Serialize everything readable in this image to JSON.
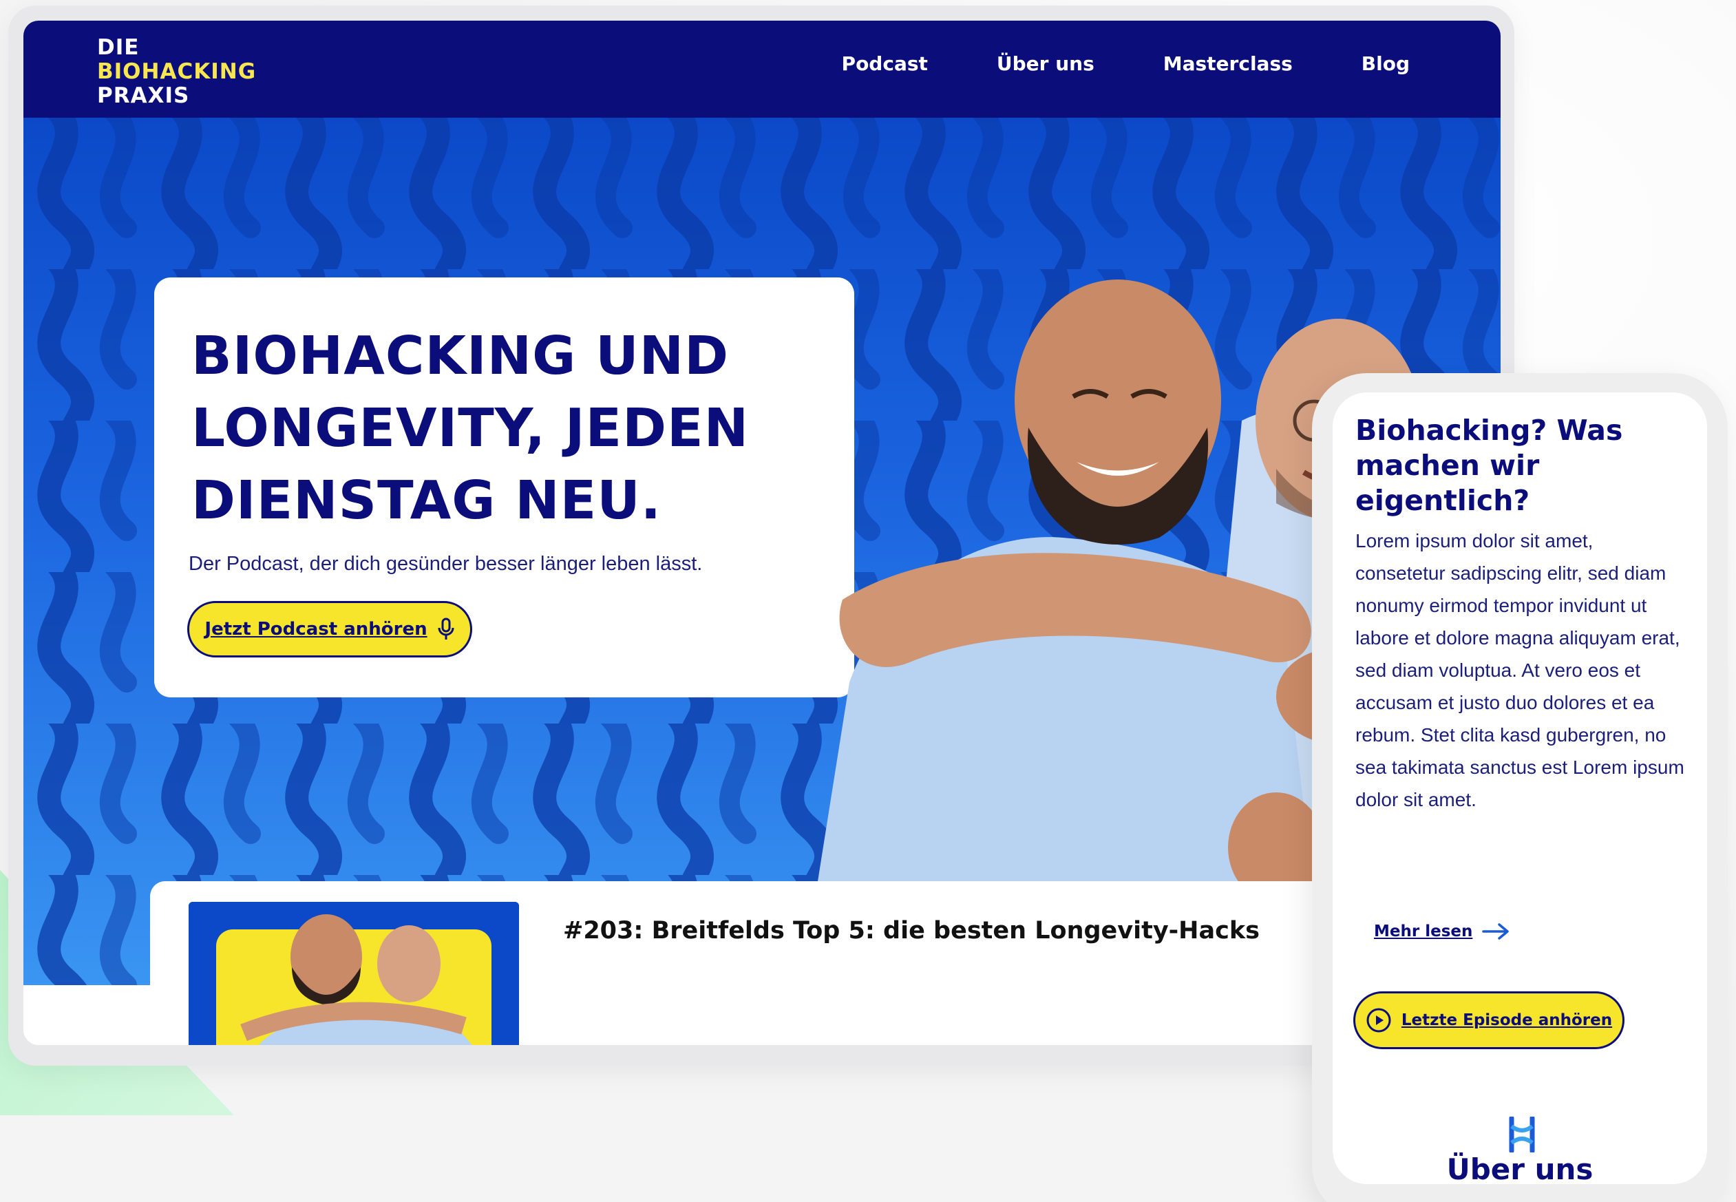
{
  "colors": {
    "navy": "#0b0e7a",
    "brand_yellow": "#f6e52a",
    "logo_yellow": "#f7e650",
    "hero_blue": "#1c66e0",
    "mint": "#b6f2c9"
  },
  "desktop": {
    "logo": {
      "line1": "DIE",
      "line2": "BIOHACKING",
      "line3": "PRAXIS"
    },
    "nav": [
      "Podcast",
      "Über uns",
      "Masterclass",
      "Blog"
    ],
    "hero": {
      "title_line1": "BIOHACKING UND",
      "title_line2": "LONGEVITY, JEDEN",
      "title_line3": "DIENSTAG NEU.",
      "subtitle": "Der Podcast, der dich gesünder besser länger leben lässt.",
      "cta_label": "Jetzt Podcast anhören",
      "cta_icon": "microphone-icon"
    },
    "episode": {
      "title": "#203: Breitfelds Top 5: die besten Longevity-Hacks"
    }
  },
  "mobile": {
    "section_title": "Biohacking? Was machen wir eigentlich?",
    "body": "Lorem ipsum dolor sit amet, consetetur sadipscing elitr, sed diam nonumy eirmod tempor invidunt ut labore et dolore magna aliquyam erat, sed diam voluptua. At vero eos et accusam et justo duo dolores et ea rebum. Stet clita kasd gubergren, no sea takimata sanctus est Lorem ipsum dolor sit amet.",
    "more_link": "Mehr lesen",
    "more_icon": "arrow-right-icon",
    "cta_label": "Letzte Episode anhören",
    "cta_icon": "play-circle-icon",
    "next_section_title": "Über uns"
  }
}
